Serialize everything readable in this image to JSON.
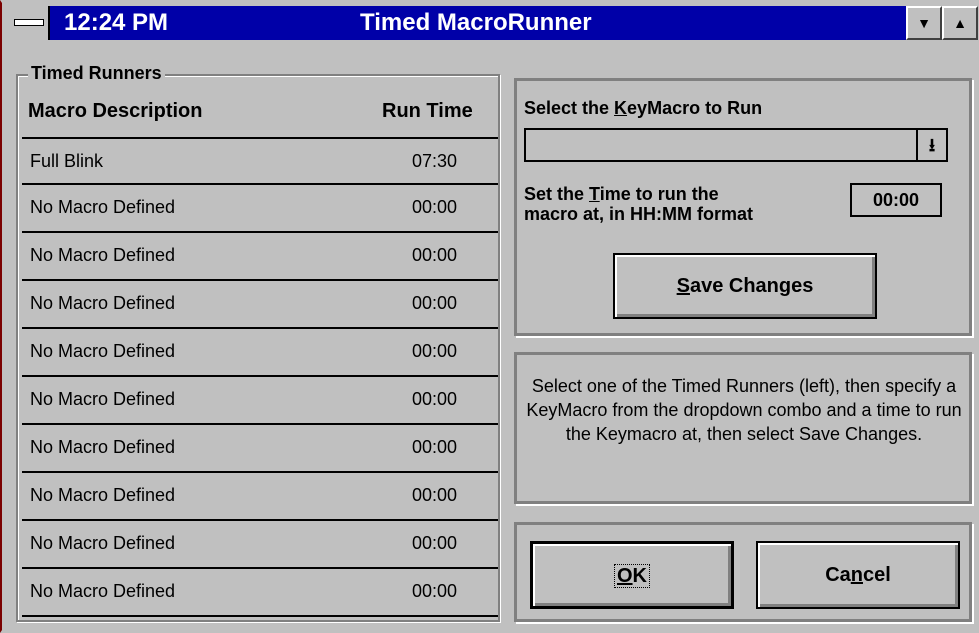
{
  "window": {
    "clock": "12:24 PM",
    "title": "Timed MacroRunner",
    "minimize_glyph": "▼",
    "maximize_glyph": "▲"
  },
  "runners": {
    "group_title": "Timed Runners",
    "col_description": "Macro Description",
    "col_time": "Run Time",
    "rows": [
      {
        "desc": "Full Blink",
        "time": "07:30"
      },
      {
        "desc": "No Macro Defined",
        "time": "00:00"
      },
      {
        "desc": "No Macro Defined",
        "time": "00:00"
      },
      {
        "desc": "No Macro Defined",
        "time": "00:00"
      },
      {
        "desc": "No Macro Defined",
        "time": "00:00"
      },
      {
        "desc": "No Macro Defined",
        "time": "00:00"
      },
      {
        "desc": "No Macro Defined",
        "time": "00:00"
      },
      {
        "desc": "No Macro Defined",
        "time": "00:00"
      },
      {
        "desc": "No Macro Defined",
        "time": "00:00"
      },
      {
        "desc": "No Macro Defined",
        "time": "00:00"
      }
    ]
  },
  "editor": {
    "select_label_pre": "Select the ",
    "select_label_accel": "K",
    "select_label_post": "eyMacro to Run",
    "combo_value": "",
    "combo_icon": "down-arrow-icon",
    "time_label_pre": "Set the ",
    "time_label_accel": "T",
    "time_label_post1": "ime to run the",
    "time_label_line2": "macro at, in HH:MM format",
    "time_value": "00:00",
    "save_accel": "S",
    "save_rest": "ave Changes"
  },
  "help": {
    "text": "Select one of the Timed Runners (left), then specify a KeyMacro from the dropdown combo and a time to run the Keymacro at, then select Save Changes."
  },
  "buttons": {
    "ok_accel": "O",
    "ok_rest": "K",
    "cancel_pre": "Ca",
    "cancel_accel": "n",
    "cancel_post": "cel"
  }
}
